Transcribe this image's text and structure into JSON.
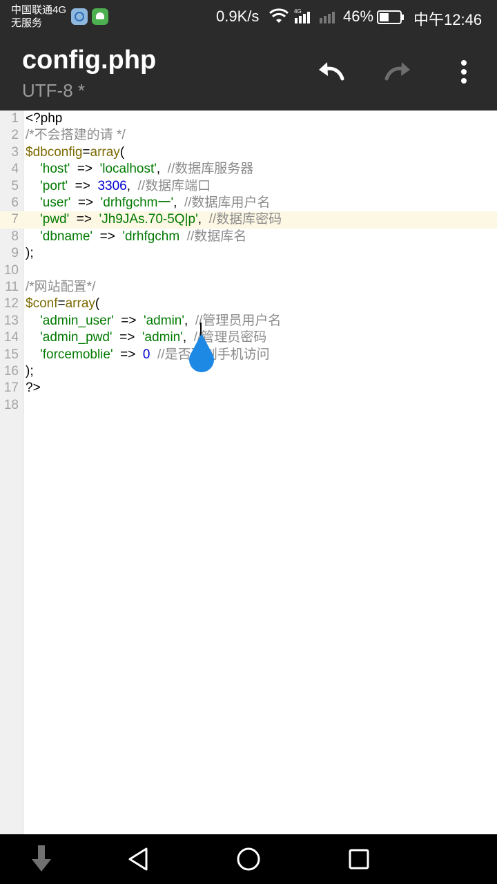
{
  "status_bar": {
    "carrier_line1": "中国联通4G",
    "carrier_line2": "无服务",
    "net_speed": "0.9K/s",
    "network_type": "4G",
    "battery_percent": "46%",
    "battery_level": 0.46,
    "time": "中午12:46"
  },
  "toolbar": {
    "title": "config.php",
    "subtitle": "UTF-8 *",
    "undo_icon": "undo-icon",
    "redo_icon": "redo-icon",
    "more_icon": "more-vert-icon"
  },
  "editor": {
    "active_line": 7,
    "lines": [
      [
        {
          "t": "plain",
          "s": "<?php"
        }
      ],
      [
        {
          "t": "comment",
          "s": "/*不会搭建的请 */"
        }
      ],
      [
        {
          "t": "var",
          "s": "$dbconfig"
        },
        {
          "t": "plain",
          "s": "="
        },
        {
          "t": "func",
          "s": "array"
        },
        {
          "t": "plain",
          "s": "("
        }
      ],
      [
        {
          "t": "plain",
          "s": "    "
        },
        {
          "t": "str",
          "s": "'host'"
        },
        {
          "t": "plain",
          "s": "  =>  "
        },
        {
          "t": "str",
          "s": "'localhost'"
        },
        {
          "t": "plain",
          "s": ",  "
        },
        {
          "t": "comment",
          "s": "//数据库服务器"
        }
      ],
      [
        {
          "t": "plain",
          "s": "    "
        },
        {
          "t": "str",
          "s": "'port'"
        },
        {
          "t": "plain",
          "s": "  =>  "
        },
        {
          "t": "num",
          "s": "3306"
        },
        {
          "t": "plain",
          "s": ",  "
        },
        {
          "t": "comment",
          "s": "//数据库端口"
        }
      ],
      [
        {
          "t": "plain",
          "s": "    "
        },
        {
          "t": "str",
          "s": "'user'"
        },
        {
          "t": "plain",
          "s": "  =>  "
        },
        {
          "t": "str",
          "s": "'drhfgchm一'"
        },
        {
          "t": "plain",
          "s": ",  "
        },
        {
          "t": "comment",
          "s": "//数据库用户名"
        }
      ],
      [
        {
          "t": "plain",
          "s": "    "
        },
        {
          "t": "str",
          "s": "'pwd'"
        },
        {
          "t": "plain",
          "s": "  =>  "
        },
        {
          "t": "str",
          "s": "'Jh9JAs.70-5Q|p'"
        },
        {
          "t": "plain",
          "s": ",  "
        },
        {
          "t": "comment",
          "s": "//数据库密码"
        }
      ],
      [
        {
          "t": "plain",
          "s": "    "
        },
        {
          "t": "str",
          "s": "'dbname'"
        },
        {
          "t": "plain",
          "s": "  =>  "
        },
        {
          "t": "str",
          "s": "'drhfgchm"
        },
        {
          "t": "plain",
          "s": "  "
        },
        {
          "t": "comment",
          "s": "//数据库名"
        }
      ],
      [
        {
          "t": "plain",
          "s": ");"
        }
      ],
      [],
      [
        {
          "t": "comment",
          "s": "/*网站配置*/"
        }
      ],
      [
        {
          "t": "var",
          "s": "$conf"
        },
        {
          "t": "plain",
          "s": "="
        },
        {
          "t": "func",
          "s": "array"
        },
        {
          "t": "plain",
          "s": "("
        }
      ],
      [
        {
          "t": "plain",
          "s": "    "
        },
        {
          "t": "str",
          "s": "'admin_user'"
        },
        {
          "t": "plain",
          "s": "  =>  "
        },
        {
          "t": "str",
          "s": "'admin'"
        },
        {
          "t": "plain",
          "s": ",  "
        },
        {
          "t": "comment",
          "s": "//管理员用户名"
        }
      ],
      [
        {
          "t": "plain",
          "s": "    "
        },
        {
          "t": "str",
          "s": "'admin_pwd'"
        },
        {
          "t": "plain",
          "s": "  =>  "
        },
        {
          "t": "str",
          "s": "'admin'"
        },
        {
          "t": "plain",
          "s": ",  "
        },
        {
          "t": "comment",
          "s": "//管理员密码"
        }
      ],
      [
        {
          "t": "plain",
          "s": "    "
        },
        {
          "t": "str",
          "s": "'forcemoblie'"
        },
        {
          "t": "plain",
          "s": "  =>  "
        },
        {
          "t": "num",
          "s": "0"
        },
        {
          "t": "plain",
          "s": "  "
        },
        {
          "t": "comment",
          "s": "//是否强制手机访问"
        }
      ],
      [
        {
          "t": "plain",
          "s": ");"
        }
      ],
      [
        {
          "t": "plain",
          "s": "?>"
        }
      ],
      []
    ]
  },
  "colors": {
    "bar_bg": "#2b2b2b",
    "string": "#007a00",
    "number": "#0000d0",
    "variable": "#7c6a00",
    "comment": "#8b8b8b",
    "active_line_bg": "#fdf8e4",
    "cursor_handle": "#1e88e5"
  },
  "nav_bar": {
    "down_icon": "arrow-down-icon",
    "back_icon": "back-triangle-icon",
    "home_icon": "home-circle-icon",
    "recent_icon": "recent-square-icon"
  }
}
